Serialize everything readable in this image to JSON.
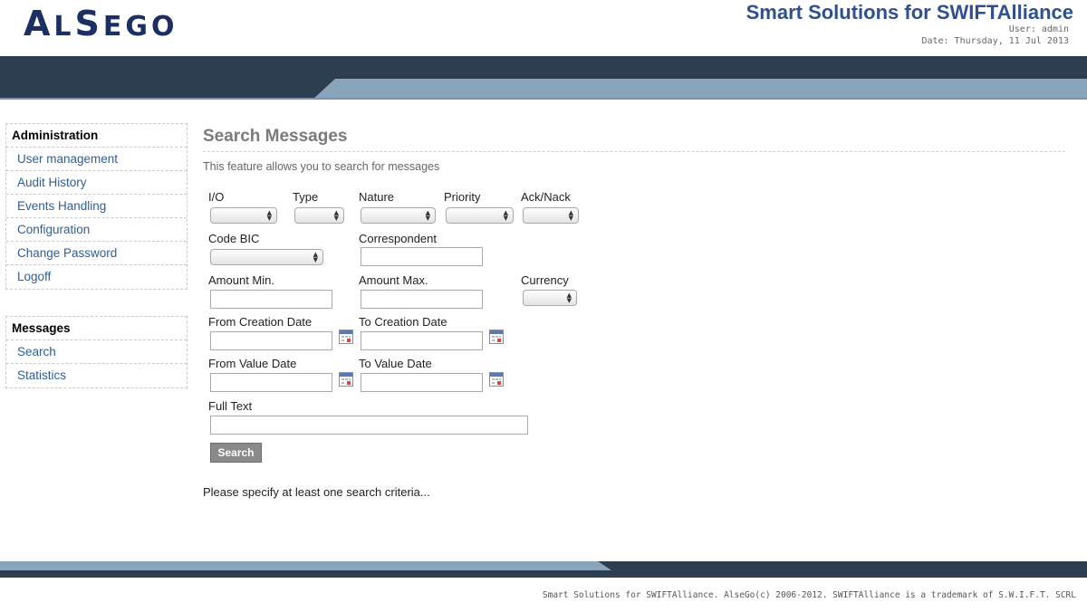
{
  "header": {
    "logo_text": "AlSego",
    "app_title": "Smart Solutions for SWIFTAlliance",
    "user_line": "User: admin",
    "date_line": "Date: Thursday, 11 Jul 2013"
  },
  "sidebar": {
    "sections": [
      {
        "heading": "Administration",
        "items": [
          "User management",
          "Audit History",
          "Events Handling",
          "Configuration",
          "Change Password",
          "Logoff"
        ]
      },
      {
        "heading": "Messages",
        "items": [
          "Search",
          "Statistics"
        ]
      }
    ]
  },
  "main": {
    "title": "Search Messages",
    "description": "This feature allows you to search for messages",
    "labels": {
      "io": "I/O",
      "type": "Type",
      "nature": "Nature",
      "priority": "Priority",
      "ack": "Ack/Nack",
      "code_bic": "Code BIC",
      "correspondent": "Correspondent",
      "amount_min": "Amount Min.",
      "amount_max": "Amount Max.",
      "currency": "Currency",
      "from_creation": "From Creation Date",
      "to_creation": "To Creation Date",
      "from_value": "From Value Date",
      "to_value": "To Value Date",
      "full_text": "Full Text"
    },
    "values": {
      "io": "",
      "type": "",
      "nature": "",
      "priority": "",
      "ack": "",
      "code_bic": "",
      "currency": "",
      "correspondent": "",
      "amount_min": "",
      "amount_max": "",
      "from_creation": "",
      "to_creation": "",
      "from_value": "",
      "to_value": "",
      "full_text": ""
    },
    "search_button": "Search",
    "status_message": "Please specify at least one search criteria..."
  },
  "footer": {
    "text": "Smart Solutions for SWIFTAlliance. AlseGo(c) 2006-2012. SWIFTAlliance is a trademark of S.W.I.F.T. SCRL"
  },
  "colors": {
    "banner_dark": "#2c3e4f",
    "banner_light": "#8aa4bc",
    "link": "#2e5e9a",
    "title_blue": "#2f4f8f"
  },
  "icons": {
    "select_arrow": "up-down-arrows-icon",
    "calendar": "calendar-icon"
  }
}
